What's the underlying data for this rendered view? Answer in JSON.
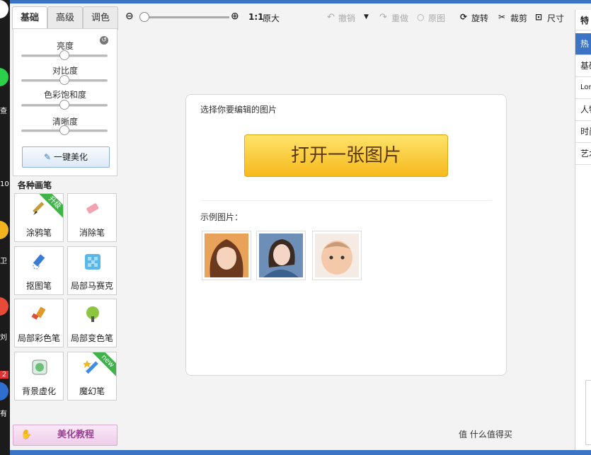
{
  "tabs": [
    "基础",
    "高级",
    "调色"
  ],
  "adjust": {
    "sliders": [
      {
        "label": "亮度",
        "value": 0.5
      },
      {
        "label": "对比度",
        "value": 0.5
      },
      {
        "label": "色彩饱和度",
        "value": 0.5
      },
      {
        "label": "清晰度",
        "value": 0.5
      }
    ],
    "beautify_label": "一键美化"
  },
  "brushes": {
    "title": "各种画笔",
    "tools": [
      {
        "label": "涂鸦笔",
        "badge": "升级",
        "icon": "paintbrush-icon"
      },
      {
        "label": "消除笔",
        "badge": "",
        "icon": "eraser-icon"
      },
      {
        "label": "抠图笔",
        "badge": "",
        "icon": "cutout-pen-icon"
      },
      {
        "label": "局部马赛克",
        "badge": "",
        "icon": "mosaic-icon"
      },
      {
        "label": "局部彩色笔",
        "badge": "",
        "icon": "color-brush-icon"
      },
      {
        "label": "局部变色笔",
        "badge": "",
        "icon": "color-change-icon"
      },
      {
        "label": "背景虚化",
        "badge": "",
        "icon": "blur-background-icon"
      },
      {
        "label": "魔幻笔",
        "badge": "new",
        "icon": "magic-wand-icon"
      }
    ]
  },
  "tutorial_label": "美化教程",
  "toolbar": {
    "zoom_ratio": "1:1",
    "original_size": "原大",
    "undo": "撤销",
    "redo": "重做",
    "original": "原图",
    "rotate": "旋转",
    "crop": "裁剪",
    "size": "尺寸"
  },
  "main": {
    "choose_prompt": "选择你要编辑的图片",
    "open_button": "打开一张图片",
    "sample_label": "示例图片："
  },
  "right_tabs": [
    "特",
    "热",
    "基础",
    "Lom",
    "人物",
    "时尚",
    "艺术"
  ],
  "watermark": "值 什么值得买",
  "desktop_texts": [
    "查",
    "10",
    "卫",
    "刘",
    "2",
    "有"
  ]
}
